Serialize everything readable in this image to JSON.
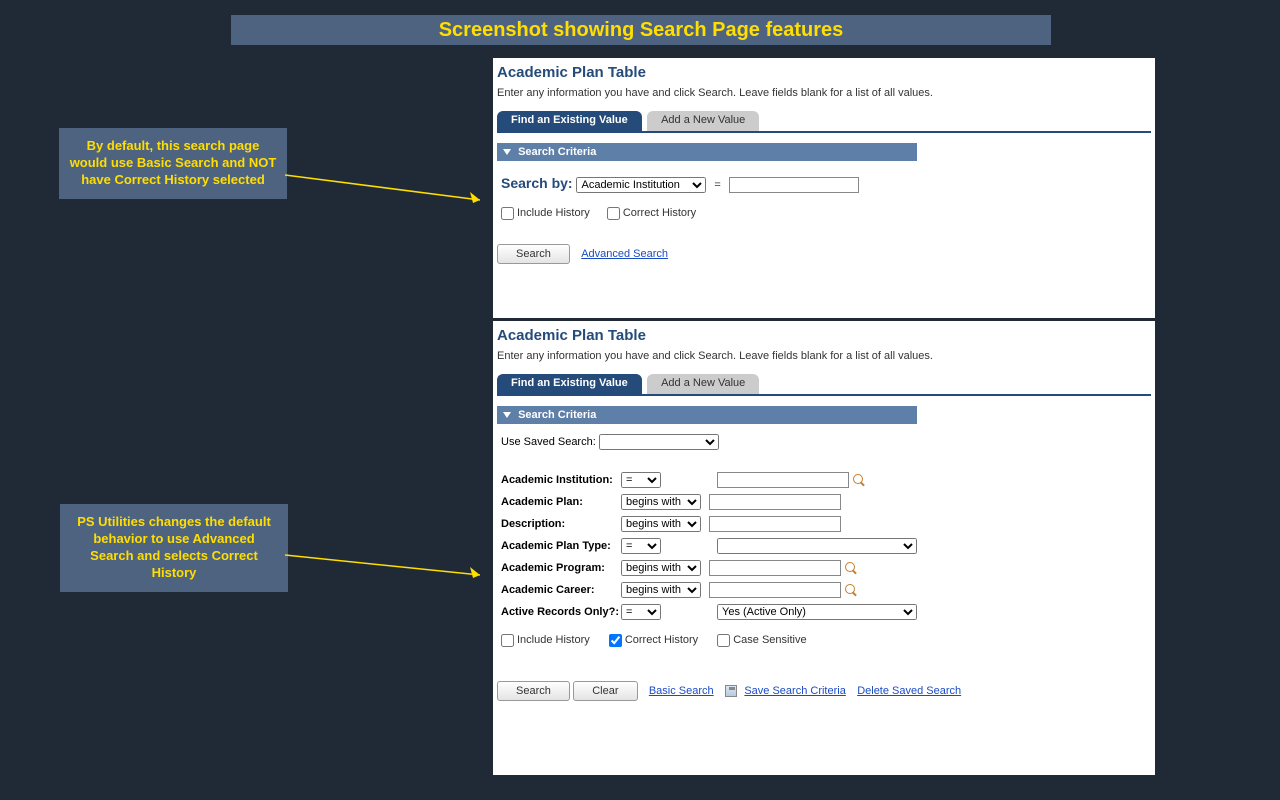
{
  "title": "Screenshot showing Search Page features",
  "callouts": {
    "c1": "By default, this search page would use Basic Search and NOT have Correct History selected",
    "c2": "PS Utilities changes the default behavior to use Advanced Search and selects Correct History"
  },
  "panel": {
    "page_title": "Academic Plan Table",
    "instructions": "Enter any information you have and click Search. Leave fields blank for a list of all values.",
    "tab_active": "Find an Existing Value",
    "tab_inactive": "Add a New Value",
    "criteria_header": "Search Criteria"
  },
  "basic": {
    "search_by_label": "Search by:",
    "search_by_option": "Academic Institution",
    "include_history": "Include History",
    "correct_history": "Correct History",
    "search_btn": "Search",
    "adv_link": "Advanced Search"
  },
  "adv": {
    "saved_label": "Use Saved Search:",
    "rows": {
      "r1": {
        "label": "Academic Institution:",
        "op": "="
      },
      "r2": {
        "label": "Academic Plan:",
        "op": "begins with"
      },
      "r3": {
        "label": "Description:",
        "op": "begins with"
      },
      "r4": {
        "label": "Academic Plan Type:",
        "op": "="
      },
      "r5": {
        "label": "Academic Program:",
        "op": "begins with"
      },
      "r6": {
        "label": "Academic Career:",
        "op": "begins with"
      },
      "r7": {
        "label": "Active Records Only?:",
        "op": "=",
        "val": "Yes (Active Only)"
      }
    },
    "include_history": "Include History",
    "correct_history": "Correct History",
    "case_sensitive": "Case Sensitive",
    "search_btn": "Search",
    "clear_btn": "Clear",
    "basic_link": "Basic Search",
    "save_link": "Save Search Criteria",
    "delete_link": "Delete Saved Search"
  }
}
